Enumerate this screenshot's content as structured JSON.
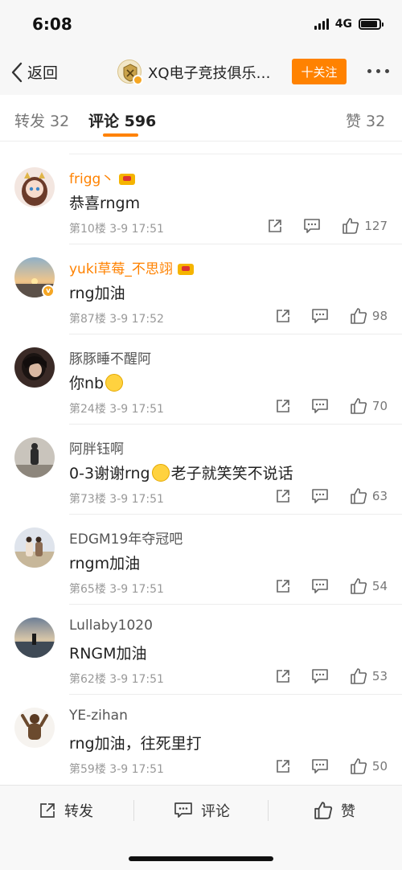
{
  "status_bar": {
    "time": "6:08",
    "network": "4G"
  },
  "nav": {
    "back_label": "返回",
    "title": "XQ电子竞技俱乐…",
    "follow_label": "十关注"
  },
  "tabs": [
    {
      "label": "转发 32"
    },
    {
      "label": "评论 596"
    },
    {
      "label": "赞 32"
    }
  ],
  "comments": [
    {
      "username": "frigg丶",
      "text": "恭喜rngm",
      "floor": "第10楼",
      "time": "3-9 17:51",
      "likes": "127"
    },
    {
      "username": "yuki草莓_不思翊",
      "text": "rng加油",
      "floor": "第87楼",
      "time": "3-9 17:52",
      "likes": "98"
    },
    {
      "username": "豚豚睡不醒阿",
      "text": "你nb",
      "floor": "第24楼",
      "time": "3-9 17:51",
      "likes": "70"
    },
    {
      "username": "阿胖钰啊",
      "text_before": "0-3谢谢rng",
      "text_after": "老子就笑笑不说话",
      "floor": "第73楼",
      "time": "3-9 17:51",
      "likes": "63"
    },
    {
      "username": "EDGM19年夺冠吧",
      "text": "rngm加油",
      "floor": "第65楼",
      "time": "3-9 17:51",
      "likes": "54"
    },
    {
      "username": "Lullaby1020",
      "text": "RNGM加油",
      "floor": "第62楼",
      "time": "3-9 17:51",
      "likes": "53"
    },
    {
      "username": "YE-zihan",
      "text": "rng加油，往死里打",
      "floor": "第59楼",
      "time": "3-9 17:51",
      "likes": "50"
    }
  ],
  "bottom_bar": {
    "repost_label": "转发",
    "comment_label": "评论",
    "like_label": "赞"
  },
  "colors": {
    "accent": "#ff8200",
    "vip_name": "#ff8200",
    "meta_text": "#999999"
  }
}
